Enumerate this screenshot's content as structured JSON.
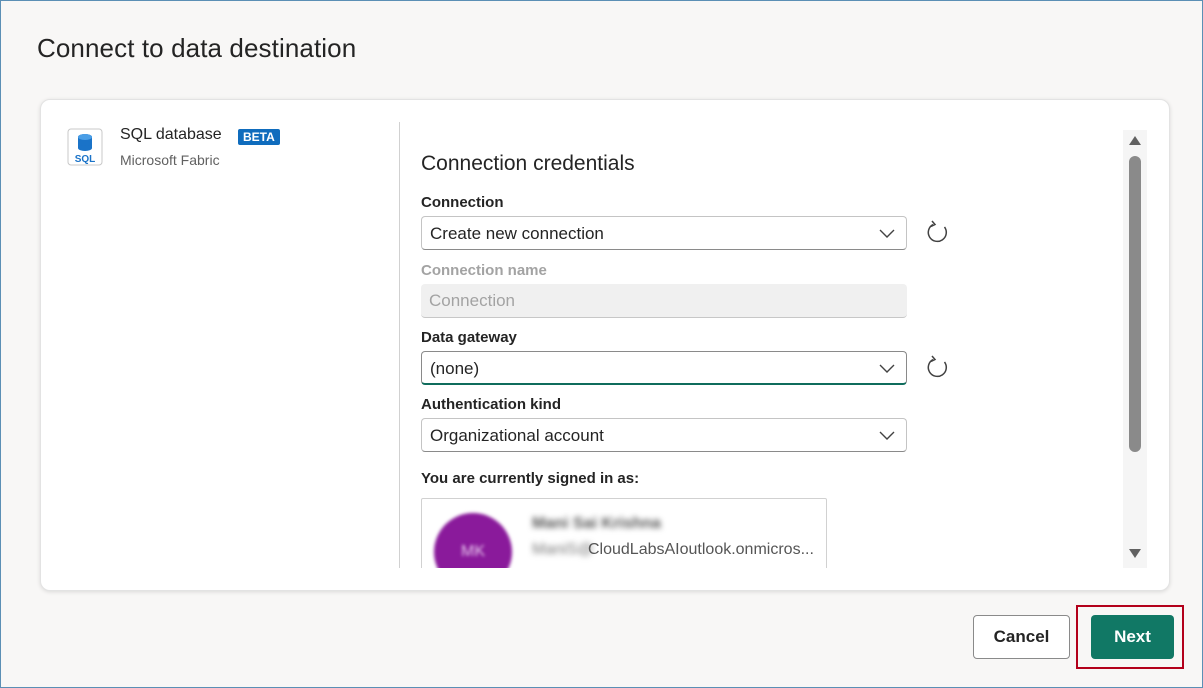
{
  "dialog": {
    "title": "Connect to data destination"
  },
  "source": {
    "name": "SQL database",
    "badge": "BETA",
    "provider": "Microsoft Fabric",
    "icon": "sql-database-icon"
  },
  "form": {
    "section_title": "Connection credentials",
    "connection": {
      "label": "Connection",
      "value": "Create new connection"
    },
    "connection_name": {
      "label": "Connection name",
      "placeholder": "Connection"
    },
    "data_gateway": {
      "label": "Data gateway",
      "value": "(none)"
    },
    "authentication_kind": {
      "label": "Authentication kind",
      "value": "Organizational account"
    },
    "signed_in": {
      "label": "You are currently signed in as:",
      "avatar_initials": "MK",
      "display_name": "Mani Sai Krishna",
      "email_prefix": "ManiS@",
      "email_visible": "CloudLabsAIoutlook.onmicros..."
    }
  },
  "footer": {
    "cancel_label": "Cancel",
    "next_label": "Next"
  },
  "colors": {
    "primary": "#117865",
    "beta_badge": "#0f6cbd",
    "avatar": "#8a1a9b",
    "highlight": "#b3001b"
  }
}
